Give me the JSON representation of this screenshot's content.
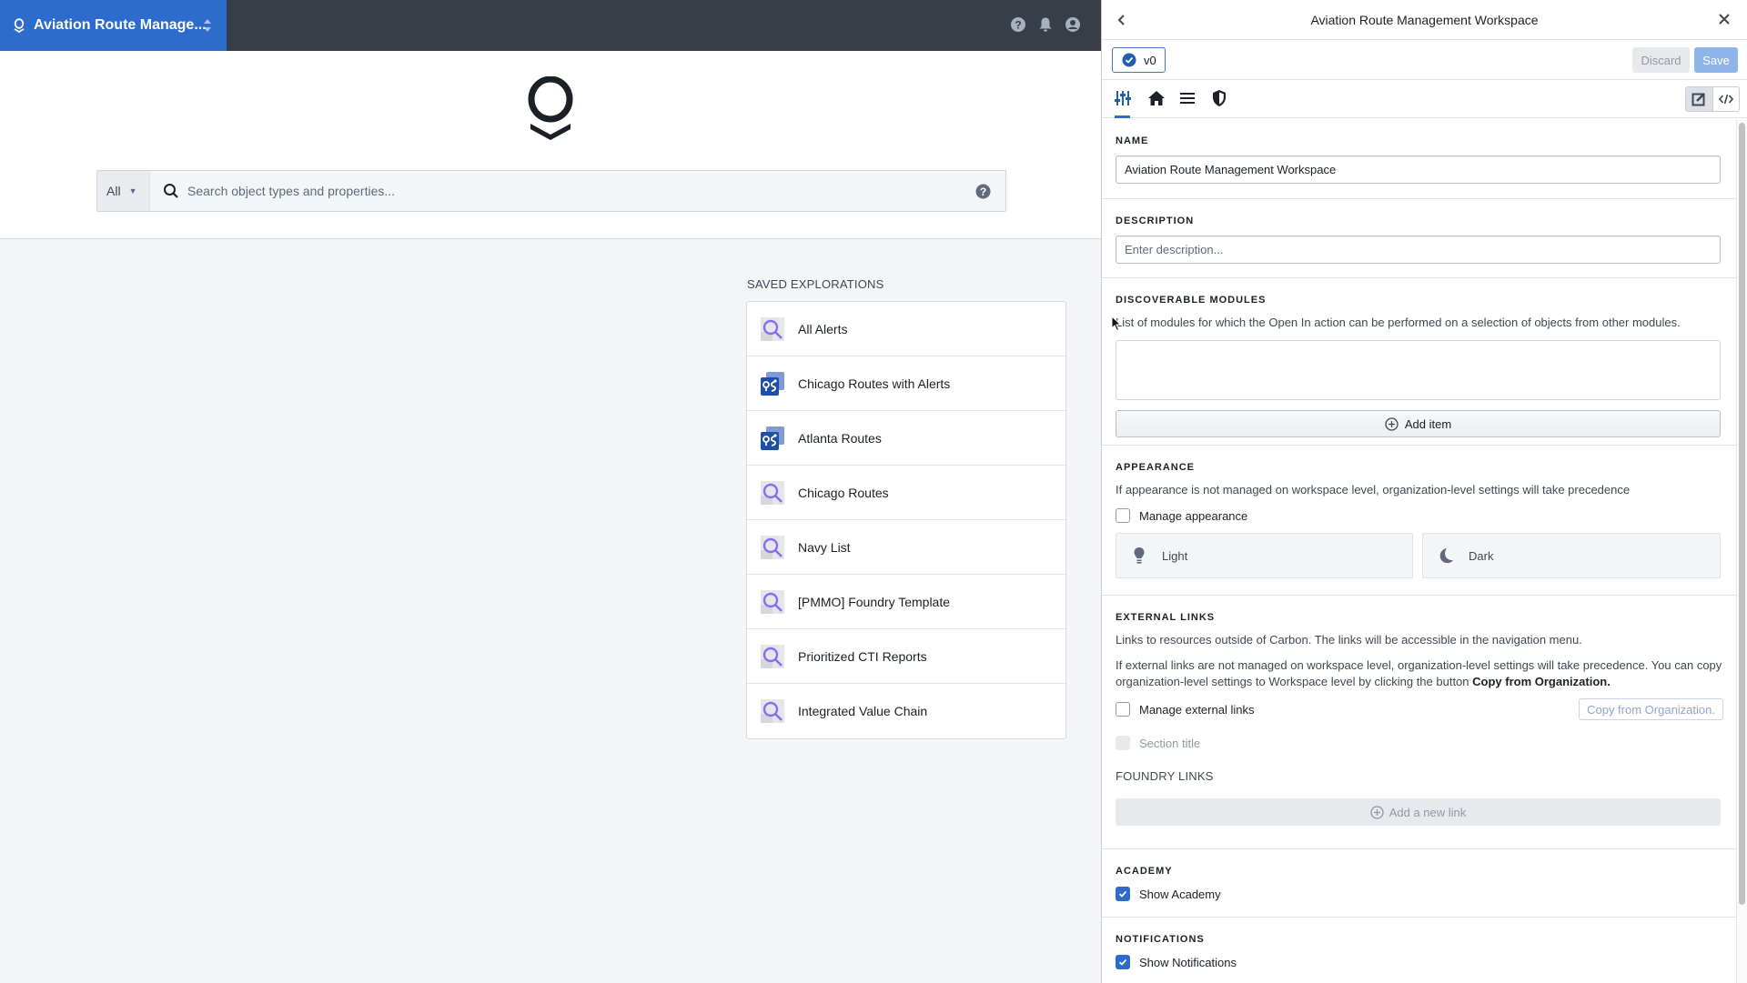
{
  "topbar": {
    "app_title": "Aviation Route Manage...",
    "brand_color": "#2d6bcc",
    "icons": [
      "help-icon",
      "notifications-bell-icon",
      "user-account-icon"
    ]
  },
  "search": {
    "scope_label": "All",
    "placeholder": "Search object types and properties..."
  },
  "saved": {
    "heading": "SAVED EXPLORATIONS",
    "items": [
      {
        "label": "All Alerts",
        "icon": "exploration-search-icon"
      },
      {
        "label": "Chicago Routes with Alerts",
        "icon": "map-route-icon"
      },
      {
        "label": "Atlanta Routes",
        "icon": "map-route-icon"
      },
      {
        "label": "Chicago Routes",
        "icon": "exploration-search-icon"
      },
      {
        "label": "Navy List",
        "icon": "exploration-search-icon"
      },
      {
        "label": "[PMMO] Foundry Template",
        "icon": "exploration-search-icon"
      },
      {
        "label": "Prioritized CTI Reports",
        "icon": "exploration-search-icon"
      },
      {
        "label": "Integrated Value Chain",
        "icon": "exploration-search-icon"
      }
    ]
  },
  "panel": {
    "title": "Aviation Route Management Workspace",
    "version_label": "v0",
    "discard_label": "Discard",
    "save_label": "Save",
    "tabs": [
      "settings-sliders",
      "home",
      "menu-list",
      "shield"
    ],
    "name": {
      "label": "NAME",
      "value": "Aviation Route Management Workspace"
    },
    "description": {
      "label": "DESCRIPTION",
      "placeholder": "Enter description..."
    },
    "modules": {
      "label": "DISCOVERABLE MODULES",
      "help": "List of modules for which the Open In action can be performed on a selection of objects from other modules.",
      "add_label": "Add item"
    },
    "appearance": {
      "label": "APPEARANCE",
      "help": "If appearance is not managed on workspace level, organization-level settings will take precedence",
      "manage_label": "Manage appearance",
      "manage_checked": false,
      "light_label": "Light",
      "dark_label": "Dark"
    },
    "external_links": {
      "label": "EXTERNAL LINKS",
      "help1": "Links to resources outside of Carbon. The links will be accessible in the navigation menu.",
      "help2_prefix": "If external links are not managed on workspace level, organization-level settings will take precedence. You can copy organization-level settings to Workspace level by clicking the button ",
      "help2_bold": "Copy from Organization.",
      "manage_label": "Manage external links",
      "manage_checked": false,
      "copy_button": "Copy from Organization.",
      "section_title_label": "Section title",
      "foundry_links_label": "FOUNDRY LINKS",
      "add_link_label": "Add a new link"
    },
    "academy": {
      "label": "ACADEMY",
      "show_label": "Show Academy",
      "checked": true
    },
    "notifications": {
      "label": "NOTIFICATIONS",
      "show_label": "Show Notifications",
      "checked": true
    }
  }
}
